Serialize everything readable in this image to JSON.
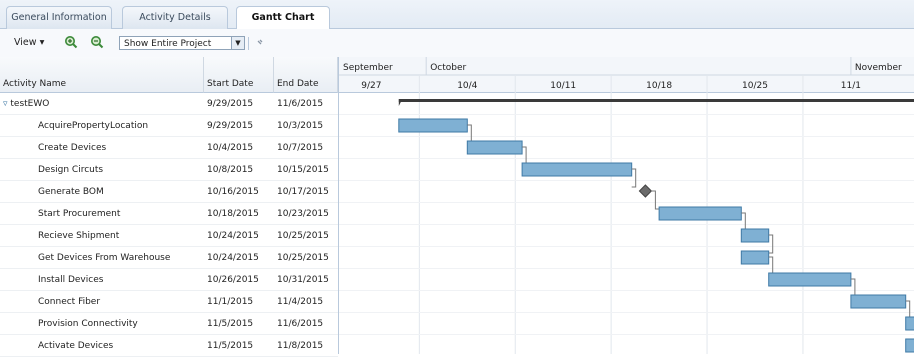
{
  "tabs": [
    {
      "label": "General Information",
      "active": false
    },
    {
      "label": "Activity Details",
      "active": false
    },
    {
      "label": "Gantt Chart",
      "active": true
    }
  ],
  "toolbar": {
    "view_label": "View ▾",
    "zoom_in_icon": "zoom-in-icon",
    "zoom_out_icon": "zoom-out-icon",
    "select_value": "Show Entire Project",
    "extra_icon": "link-icon"
  },
  "columns": {
    "activity": "Activity Name",
    "start": "Start Date",
    "end": "End Date"
  },
  "timeline": {
    "months": [
      "September",
      "October",
      "November"
    ],
    "weeks": [
      "9/27",
      "10/4",
      "10/11",
      "10/18",
      "10/25",
      "11/1"
    ]
  },
  "activities": [
    {
      "name": "testEWO",
      "start": "9/29/2015",
      "end": "11/6/2015",
      "summary": true
    },
    {
      "name": "AcquirePropertyLocation",
      "start": "9/29/2015",
      "end": "10/3/2015"
    },
    {
      "name": "Create Devices",
      "start": "10/4/2015",
      "end": "10/7/2015"
    },
    {
      "name": "Design Circuts",
      "start": "10/8/2015",
      "end": "10/15/2015"
    },
    {
      "name": "Generate BOM",
      "start": "10/16/2015",
      "end": "10/17/2015",
      "milestone": true
    },
    {
      "name": "Start Procurement",
      "start": "10/18/2015",
      "end": "10/23/2015"
    },
    {
      "name": "Recieve Shipment",
      "start": "10/24/2015",
      "end": "10/25/2015"
    },
    {
      "name": "Get Devices From Warehouse",
      "start": "10/24/2015",
      "end": "10/25/2015"
    },
    {
      "name": "Install Devices",
      "start": "10/26/2015",
      "end": "10/31/2015"
    },
    {
      "name": "Connect Fiber",
      "start": "11/1/2015",
      "end": "11/4/2015"
    },
    {
      "name": "Provision Connectivity",
      "start": "11/5/2015",
      "end": "11/6/2015"
    },
    {
      "name": "Activate Devices",
      "start": "11/5/2015",
      "end": "11/8/2015"
    }
  ],
  "colors": {
    "bar_fill": "#7fb0d3",
    "bar_stroke": "#3f7aa6",
    "summary": "#3a3a3a",
    "milestone": "#6b6b6b",
    "header_border": "#b9c9dc"
  }
}
